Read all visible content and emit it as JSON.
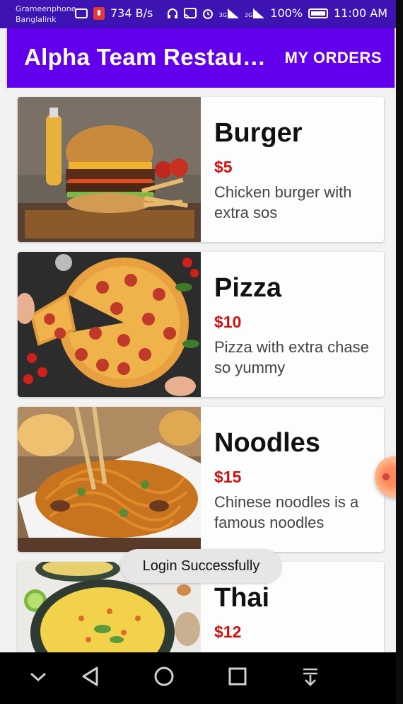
{
  "status_bar": {
    "carrier_1": "Grameenphone",
    "carrier_2": "Banglalink",
    "net_speed": "734 B/s",
    "sig1_label": "3G",
    "sig2_label": "2G",
    "battery": "100%",
    "time": "11:00 AM",
    "bg_color": "#3d13b3"
  },
  "app_bar": {
    "title": "Alpha Team Restau…",
    "my_orders_label": "MY ORDERS",
    "bg_color": "#6200ee"
  },
  "menu_items": [
    {
      "name": "Burger",
      "price": "$5",
      "description": "Chicken burger with extra sos",
      "image_icon": "burger-image"
    },
    {
      "name": "Pizza",
      "price": "$10",
      "description": "Pizza with extra chase so yummy",
      "image_icon": "pizza-image"
    },
    {
      "name": "Noodles",
      "price": "$15",
      "description": "Chinese noodles is a famous noodles",
      "image_icon": "noodles-image"
    },
    {
      "name": "Thai",
      "price": "$12",
      "description": "",
      "image_icon": "thai-soup-image"
    }
  ],
  "toast": {
    "message": "Login Successfully"
  },
  "price_color": "#d01010",
  "nav_bar": {
    "buttons": [
      "chevron-down-icon",
      "back-icon",
      "home-icon",
      "recents-icon",
      "notification-pull-icon"
    ]
  }
}
